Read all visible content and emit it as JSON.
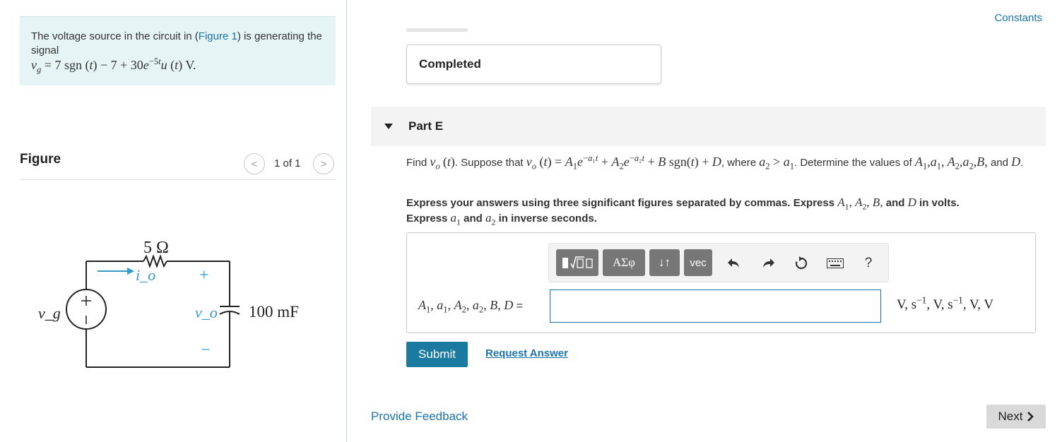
{
  "header": {
    "constants_link": "Constants"
  },
  "intro": {
    "text_before": "The voltage source in the circuit in (",
    "figure_link": "Figure 1",
    "text_after": ") is generating the signal",
    "equation": "v_g = 7 sgn(t) − 7 + 30e^(−5t) u(t) V."
  },
  "figure": {
    "title": "Figure",
    "pager": "1 of 1",
    "prev_icon": "chevron-left-icon",
    "next_icon": "chevron-right-icon",
    "resistor_label": "5 Ω",
    "capacitor_label": "100 mF",
    "source_label": "v_g",
    "output_label": "v_o",
    "current_label": "i_o",
    "plus": "+",
    "minus": "−"
  },
  "previous_part": {
    "status": "Completed"
  },
  "part": {
    "title": "Part E",
    "question": "Find v_o(t). Suppose that v_o(t) = A₁e^(−a₁t) + A₂e^(−a₂t) + B sgn(t) + D, where a₂ > a₁. Determine the values of A₁, a₁, A₂, a₂, B, and D.",
    "instructions": "Express your answers using three significant figures separated by commas. Express A₁, A₂, B, and D in volts. Express a₁ and a₂ in inverse seconds."
  },
  "answer": {
    "toolbar": {
      "templates_icon": "templates-icon",
      "greek_label": "ΑΣφ",
      "arrows_label": "↓↑",
      "vec_label": "vec",
      "undo_icon": "undo-icon",
      "redo_icon": "redo-icon",
      "reset_icon": "reset-icon",
      "keyboard_icon": "keyboard-icon",
      "help_label": "?"
    },
    "label": "A₁, a₁, A₂, a₂, B, D =",
    "value": "",
    "units": "V, s⁻¹, V, s⁻¹, V, V"
  },
  "actions": {
    "submit": "Submit",
    "request_answer": "Request Answer",
    "feedback": "Provide Feedback",
    "next": "Next"
  },
  "colors": {
    "accent": "#1a73a8",
    "submit_bg": "#1a7aa0",
    "intro_bg": "#e6f4f5",
    "circuit_blue": "#3399cc"
  }
}
